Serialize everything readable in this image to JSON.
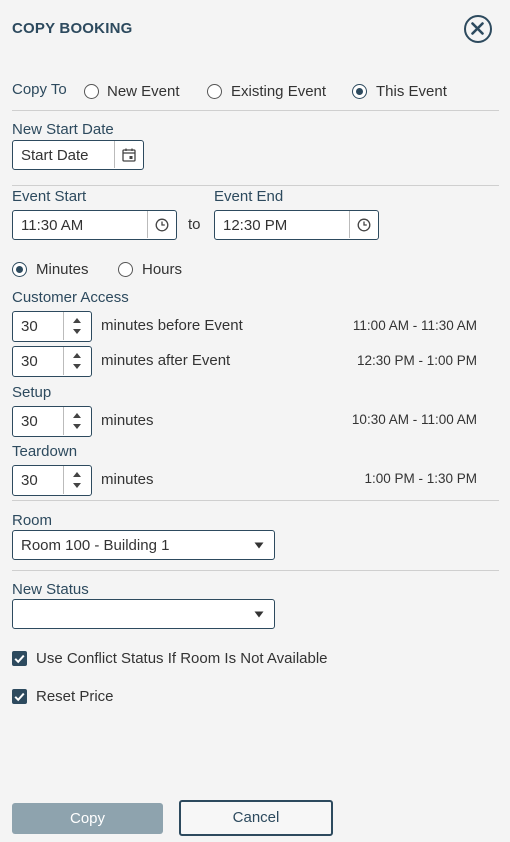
{
  "dialog": {
    "title": "COPY BOOKING"
  },
  "copy_to": {
    "label": "Copy To",
    "options": [
      "New Event",
      "Existing Event",
      "This Event"
    ],
    "selected": "This Event"
  },
  "new_start_date": {
    "label": "New Start Date",
    "placeholder": "Start Date"
  },
  "event_start": {
    "label": "Event Start",
    "value": "11:30 AM"
  },
  "separator": "to",
  "event_end": {
    "label": "Event End",
    "value": "12:30 PM"
  },
  "units": {
    "options": [
      "Minutes",
      "Hours"
    ],
    "selected": "Minutes"
  },
  "customer_access": {
    "label": "Customer Access",
    "before": {
      "value": "30",
      "text": "minutes before Event",
      "range": "11:00 AM - 11:30 AM"
    },
    "after": {
      "value": "30",
      "text": "minutes after Event",
      "range": "12:30 PM - 1:00 PM"
    }
  },
  "setup": {
    "label": "Setup",
    "value": "30",
    "text": "minutes",
    "range": "10:30 AM - 11:00 AM"
  },
  "teardown": {
    "label": "Teardown",
    "value": "30",
    "text": "minutes",
    "range": "1:00 PM - 1:30 PM"
  },
  "room": {
    "label": "Room",
    "value": "Room 100 - Building 1"
  },
  "new_status": {
    "label": "New Status",
    "value": ""
  },
  "checkboxes": {
    "use_conflict": {
      "label": "Use Conflict Status If Room Is Not Available",
      "checked": true
    },
    "reset_price": {
      "label": "Reset Price",
      "checked": true
    }
  },
  "buttons": {
    "copy": "Copy",
    "cancel": "Cancel"
  },
  "colors": {
    "accent": "#2d4a5e",
    "disabled_button": "#8ea3ae",
    "background": "#f4f4f4"
  }
}
